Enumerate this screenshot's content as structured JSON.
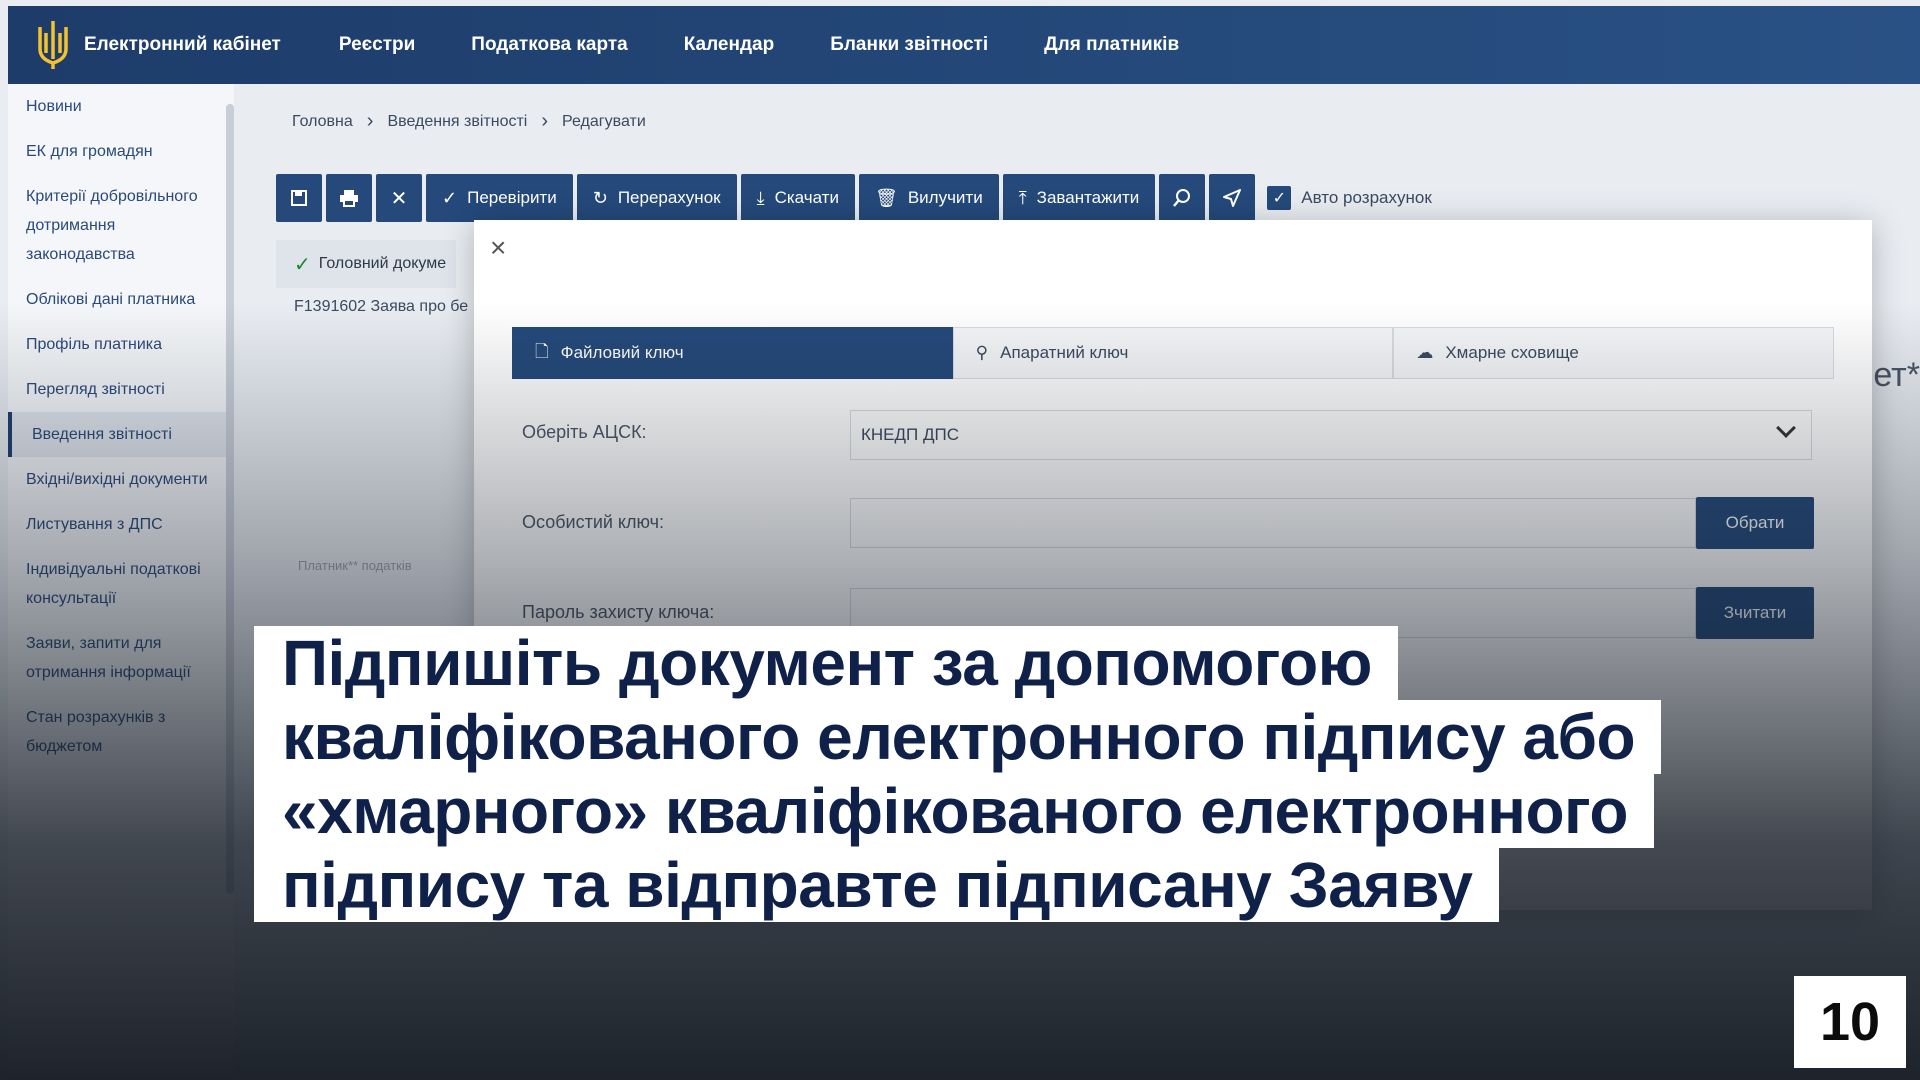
{
  "header": {
    "nav": [
      "Електронний кабінет",
      "Реєстри",
      "Податкова карта",
      "Календар",
      "Бланки звітності",
      "Для платників"
    ]
  },
  "sidebar": {
    "items": [
      "Новини",
      "ЕК для громадян",
      "Критерії добровільного дотримання законодавства",
      "Облікові дані платника",
      "Профіль платника",
      "Перегляд звітності",
      "Введення звітності",
      "Вхідні/вихідні документи",
      "Листування з ДПС",
      "Індивідуальні податкові консультації",
      "Заяви, запити для отримання інформації",
      "Стан розрахунків з бюджетом"
    ],
    "active_index": 6
  },
  "breadcrumb": [
    "Головна",
    "Введення звітності",
    "Редагувати"
  ],
  "toolbar": {
    "check": "Перевірити",
    "recalc": "Перерахунок",
    "download": "Скачати",
    "remove": "Вилучити",
    "upload": "Завантажити",
    "auto_calc": "Авто розрахунок"
  },
  "doc": {
    "tab": "Головний докуме",
    "name": "F1391602 Заява про бе",
    "faint_label": "Платник** податків",
    "side_fragment": "ет*"
  },
  "modal": {
    "tabs": [
      "Файловий ключ",
      "Апаратний ключ",
      "Хмарне сховище"
    ],
    "acsk_label": "Оберіть АЦСК:",
    "acsk_value": "КНЕДП ДПС",
    "key_label": "Особистий ключ:",
    "choose_btn": "Обрати",
    "password_label": "Пароль захисту ключа:",
    "read_btn": "Зчитати"
  },
  "caption": {
    "lines": [
      "Підпишіть документ за допомогою",
      "кваліфікованого електронного підпису або",
      "«хмарного» кваліфікованого електронного",
      "підпису та відправте підписану Заяву"
    ]
  },
  "step_number": "10",
  "colors": {
    "header": "#1d3c6a",
    "button": "#24497a",
    "caption_text": "#0f2148",
    "success": "#1b8a2c"
  }
}
